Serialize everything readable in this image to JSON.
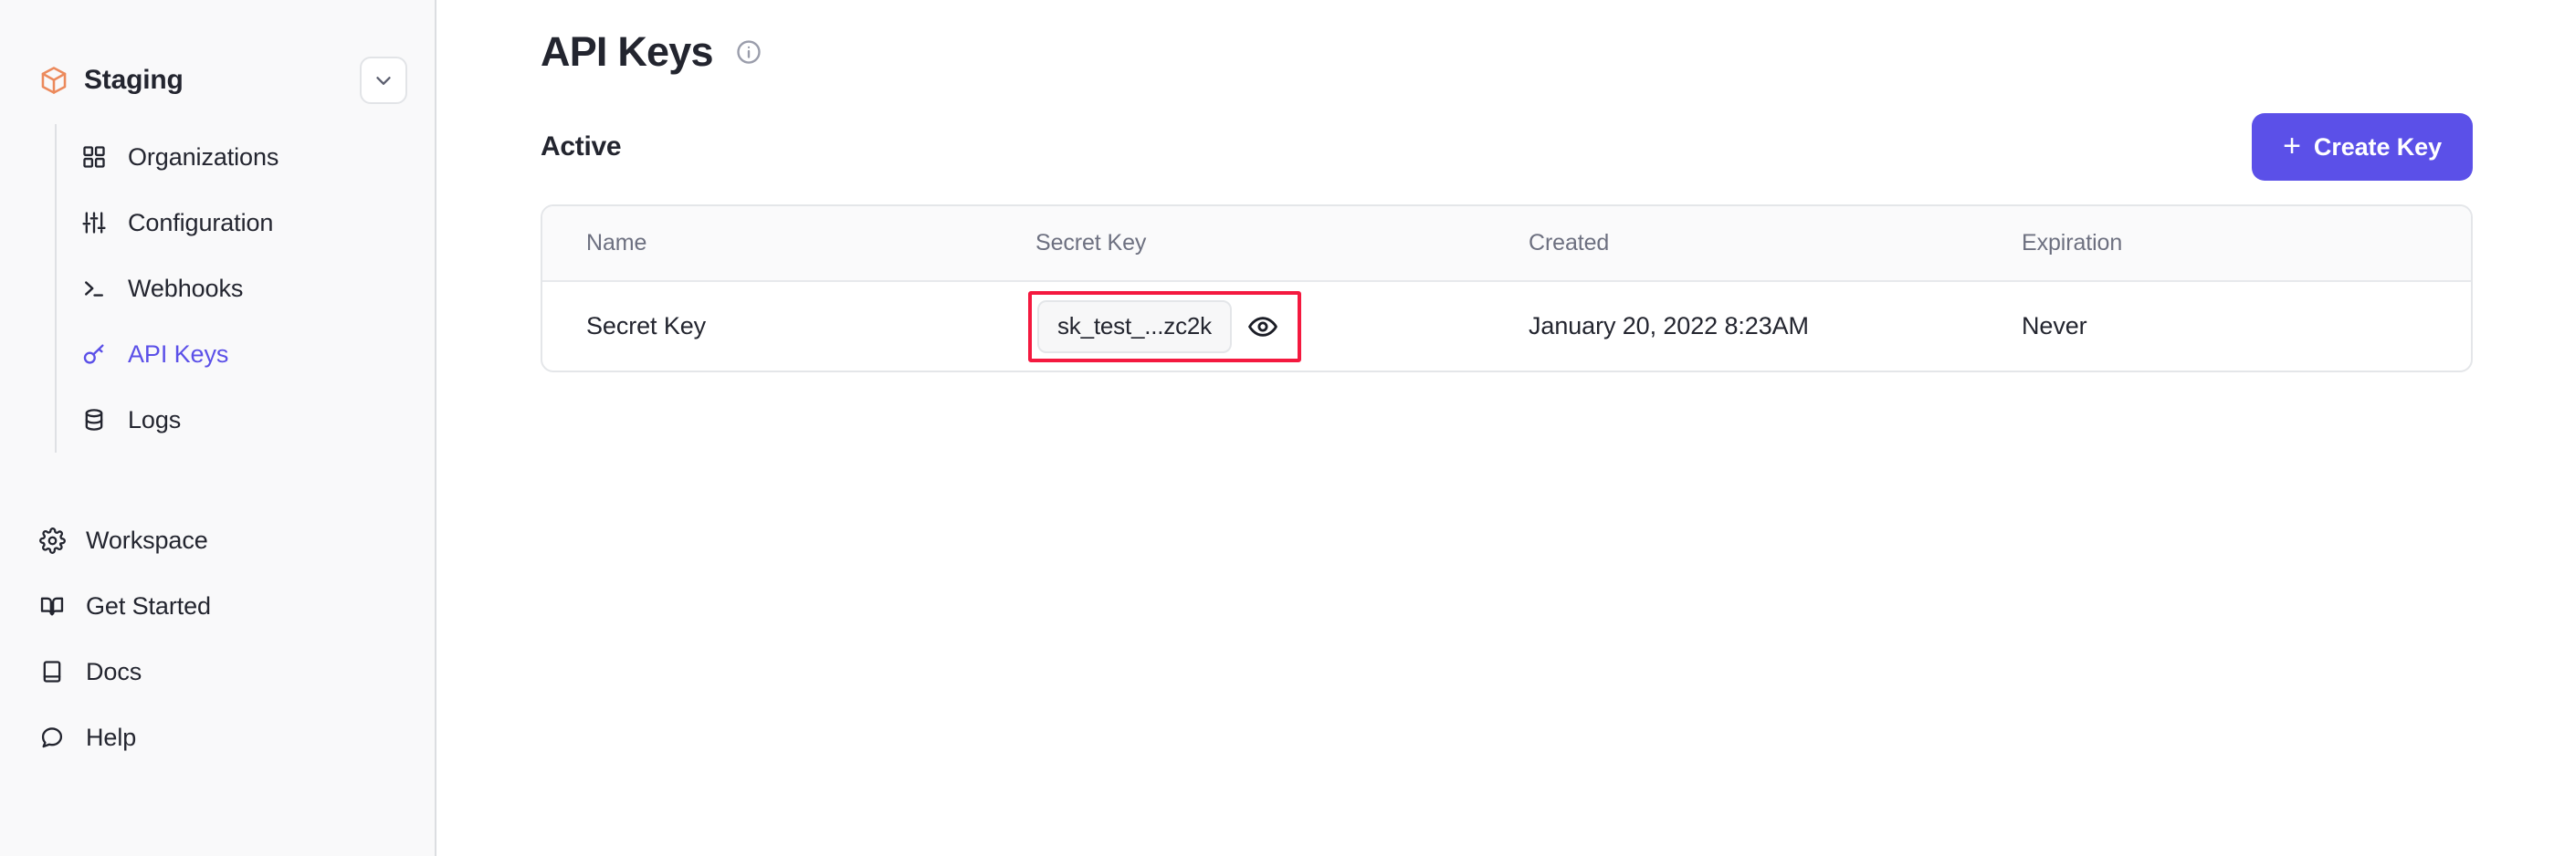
{
  "sidebar": {
    "workspace": {
      "name": "Staging",
      "icon": "cube-icon",
      "chevron": "chevron-down-icon"
    },
    "project_nav": [
      {
        "label": "Organizations",
        "icon": "grid-icon",
        "active": false
      },
      {
        "label": "Configuration",
        "icon": "sliders-icon",
        "active": false
      },
      {
        "label": "Webhooks",
        "icon": "terminal-icon",
        "active": false
      },
      {
        "label": "API Keys",
        "icon": "key-icon",
        "active": true
      },
      {
        "label": "Logs",
        "icon": "database-icon",
        "active": false
      }
    ],
    "bottom_nav": [
      {
        "label": "Workspace",
        "icon": "gear-icon"
      },
      {
        "label": "Get Started",
        "icon": "book-open-icon"
      },
      {
        "label": "Docs",
        "icon": "book-icon"
      },
      {
        "label": "Help",
        "icon": "chat-bubble-icon"
      }
    ]
  },
  "main": {
    "page_title": "API Keys",
    "page_title_info_icon": "info-circle-icon",
    "section_title": "Active",
    "create_button": {
      "label": "Create Key",
      "plus": "+",
      "color": "#5b50e8"
    },
    "table": {
      "columns": [
        "Name",
        "Secret Key",
        "Created",
        "Expiration",
        ""
      ],
      "rows": [
        {
          "name": "Secret Key",
          "secret_key": "sk_test_...zc2k",
          "reveal_icon": "eye-icon",
          "created": "January 20, 2022 8:23AM",
          "expiration": "Never",
          "edit_icon": "edit-square-icon",
          "highlight_color": "#f4193f"
        }
      ]
    }
  }
}
